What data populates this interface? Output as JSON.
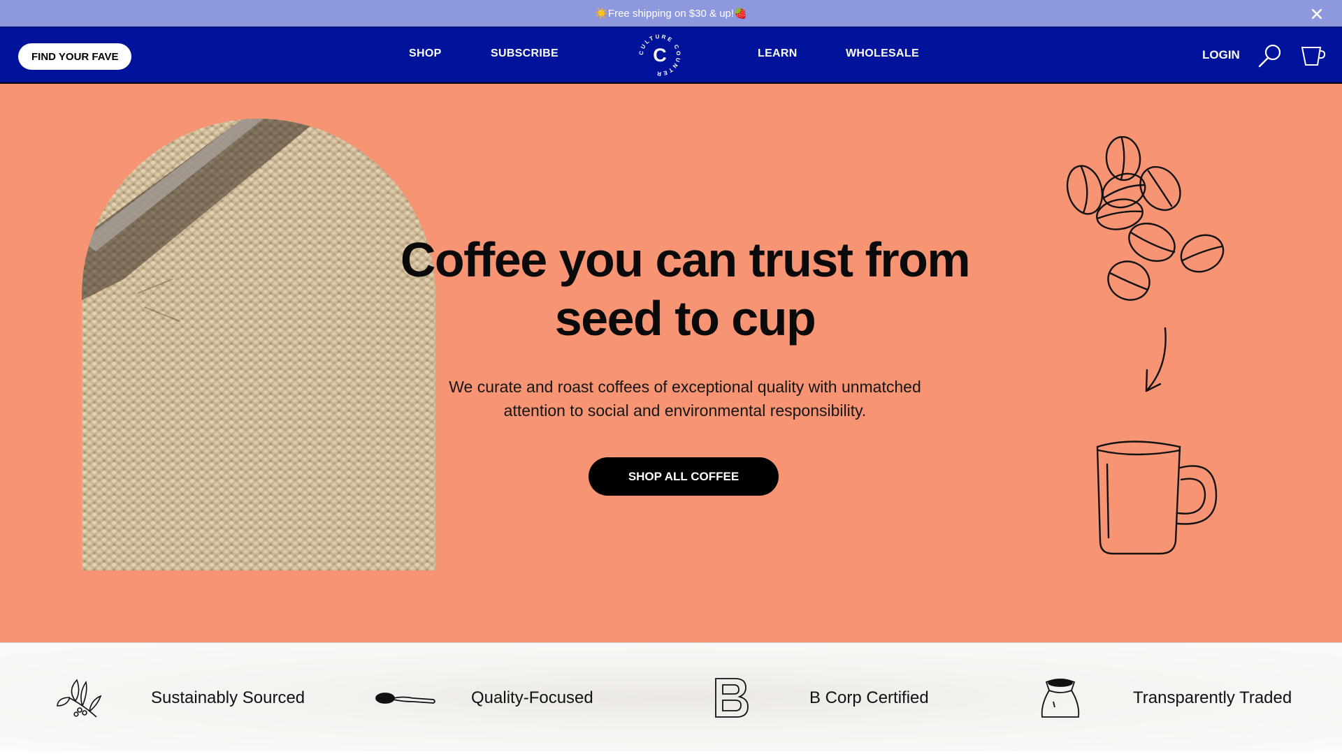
{
  "announcement": {
    "text": "☀️Free shipping on $30 & up!🍓",
    "close_icon": "close-icon"
  },
  "nav": {
    "find_button": "FIND YOUR FAVE",
    "left_links": [
      "SHOP",
      "SUBSCRIBE"
    ],
    "right_links": [
      "LEARN",
      "WHOLESALE"
    ],
    "logo_letter": "C",
    "logo_ring_text": "CULTURE COUNTER",
    "login": "LOGIN",
    "icons": [
      "search-icon",
      "cart-icon"
    ]
  },
  "hero": {
    "headline_line1": "Coffee you can trust from",
    "headline_line2": "seed to cup",
    "subtext_line1": "We curate and roast coffees of exceptional quality with unmatched",
    "subtext_line2": "attention to social and environmental responsibility.",
    "cta": "SHOP ALL COFFEE",
    "image": "drying-coffee-beans-photo",
    "illustration": "coffee-beans-to-mug-illustration"
  },
  "features": [
    {
      "icon": "coffee-plant-icon",
      "label": "Sustainably Sourced"
    },
    {
      "icon": "spoon-icon",
      "label": "Quality-Focused"
    },
    {
      "icon": "b-corp-icon",
      "label": "B Corp Certified"
    },
    {
      "icon": "coffee-sack-icon",
      "label": "Transparently Traded"
    }
  ],
  "colors": {
    "announcement_bg": "#8e98dd",
    "nav_bg": "#00139a",
    "hero_bg": "#f69473",
    "cta_bg": "#000000"
  }
}
